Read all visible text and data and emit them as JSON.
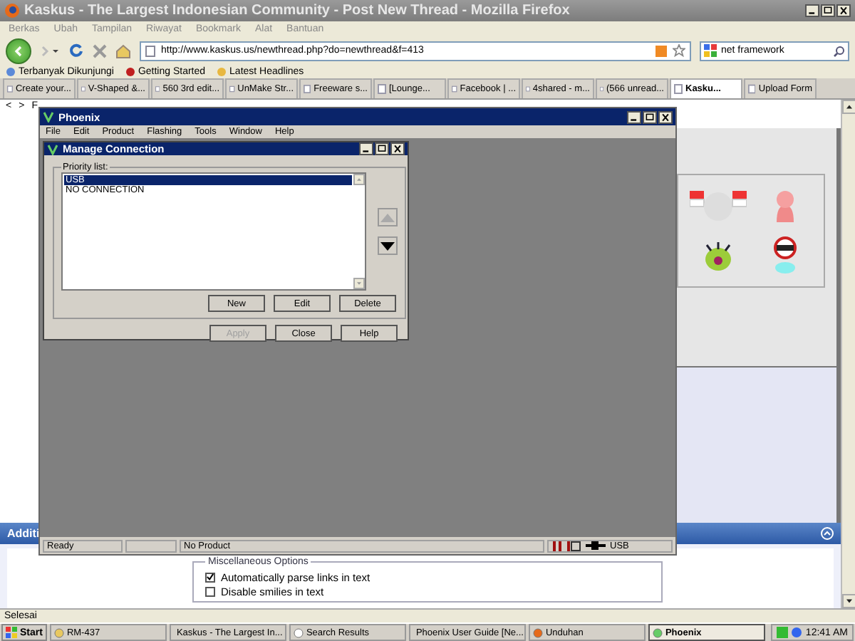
{
  "browser": {
    "title": "Kaskus - The Largest Indonesian Community - Post New Thread - Mozilla Firefox",
    "menu": [
      "Berkas",
      "Ubah",
      "Tampilan",
      "Riwayat",
      "Bookmark",
      "Alat",
      "Bantuan"
    ],
    "url": "http://www.kaskus.us/newthread.php?do=newthread&f=413",
    "search": "net framework",
    "bookmarks": [
      "Terbanyak Dikunjungi",
      "Getting Started",
      "Latest Headlines"
    ],
    "tabs": [
      {
        "label": "Create your...",
        "selected": false
      },
      {
        "label": "V-Shaped &...",
        "selected": false
      },
      {
        "label": "560 3rd edit...",
        "selected": false
      },
      {
        "label": "UnMake Str...",
        "selected": false
      },
      {
        "label": "Freeware s...",
        "selected": false
      },
      {
        "label": "[Lounge...",
        "selected": false
      },
      {
        "label": "Facebook | ...",
        "selected": false
      },
      {
        "label": "4shared - m...",
        "selected": false
      },
      {
        "label": "(566 unread...",
        "selected": false
      },
      {
        "label": "Kasku...",
        "selected": true
      },
      {
        "label": "Upload Form",
        "selected": false
      }
    ],
    "status": "Selesai"
  },
  "page": {
    "nav": [
      "<",
      ">",
      "F"
    ],
    "section_title": "Additi",
    "options_legend": "Miscellaneous Options",
    "options": [
      {
        "label": "Automatically parse links in text",
        "checked": true
      },
      {
        "label": "Disable smilies in text",
        "checked": false
      }
    ]
  },
  "phoenix": {
    "title": "Phoenix",
    "menu": [
      "File",
      "Edit",
      "Product",
      "Flashing",
      "Tools",
      "Window",
      "Help"
    ],
    "status": {
      "state": "Ready",
      "product": "No Product",
      "connection": "USB"
    }
  },
  "dialog": {
    "title": "Manage Connection",
    "group": "Priority list:",
    "items": [
      {
        "label": "USB",
        "selected": true
      },
      {
        "label": "NO CONNECTION",
        "selected": false
      }
    ],
    "list_buttons": [
      "New",
      "Edit",
      "Delete"
    ],
    "buttons": [
      {
        "label": "Apply",
        "disabled": true
      },
      {
        "label": "Close",
        "disabled": false
      },
      {
        "label": "Help",
        "disabled": false
      }
    ]
  },
  "taskbar": {
    "start": "Start",
    "items": [
      {
        "label": "RM-437",
        "selected": false
      },
      {
        "label": "Kaskus - The Largest In...",
        "selected": false
      },
      {
        "label": "Search Results",
        "selected": false
      },
      {
        "label": "Phoenix User Guide [Ne...",
        "selected": false
      },
      {
        "label": "Unduhan",
        "selected": false
      },
      {
        "label": "Phoenix",
        "selected": true
      }
    ],
    "clock": "12:41 AM"
  }
}
